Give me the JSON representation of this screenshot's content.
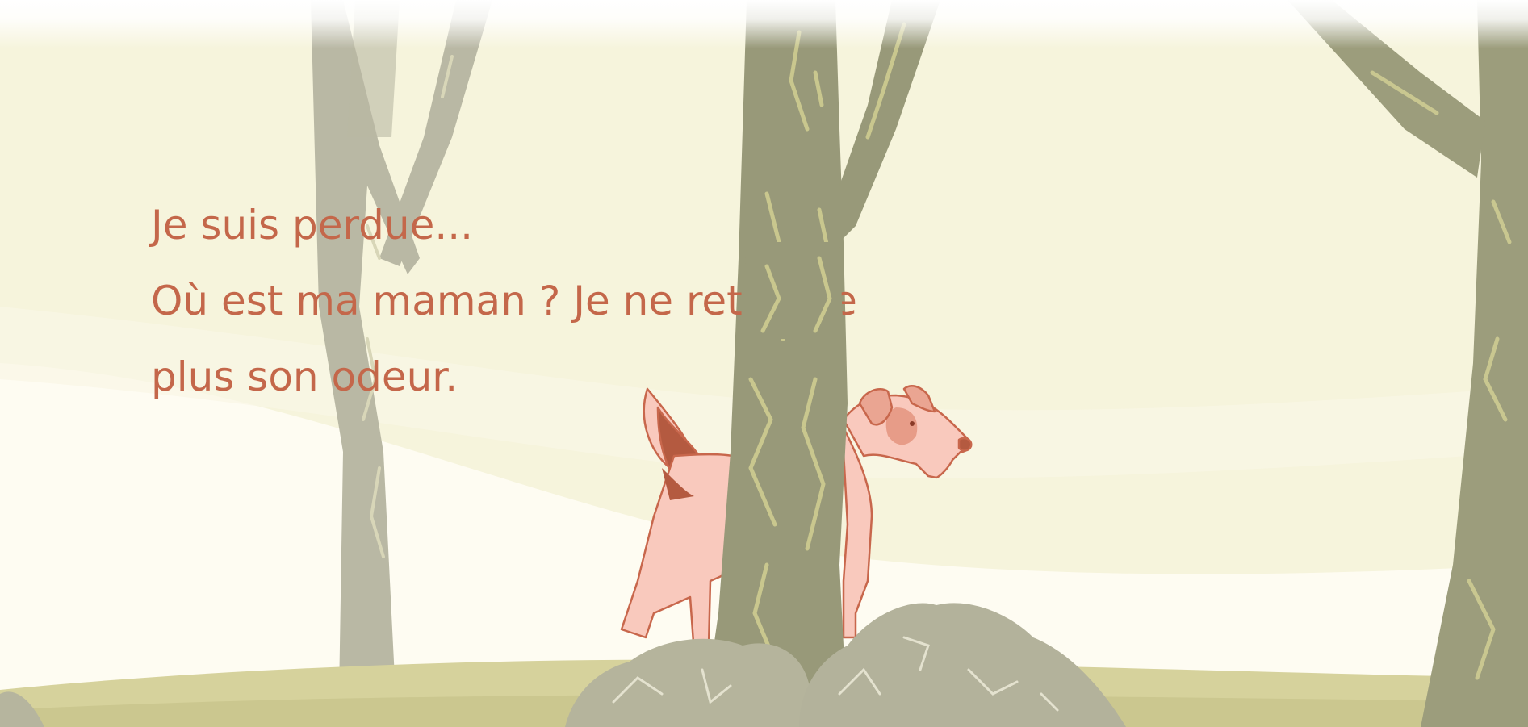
{
  "page": {
    "lines": [
      "Je suis perdue...",
      "Où est ma maman ? Je ne retrouve",
      "plus son odeur."
    ]
  },
  "illustration": {
    "subject": "dog-behind-tree",
    "colors": {
      "sky": "#f6f4dc",
      "hill": "#fdfbf0",
      "ground": "#d7d29a",
      "tree_near": "#9a9b7a",
      "tree_far": "#b9b8a2",
      "rocks": "#b4b39a",
      "dog": "#f9c9bd",
      "dog_outline": "#c8674c",
      "dog_patch": "#b45a40",
      "text": "#c4674a"
    }
  }
}
